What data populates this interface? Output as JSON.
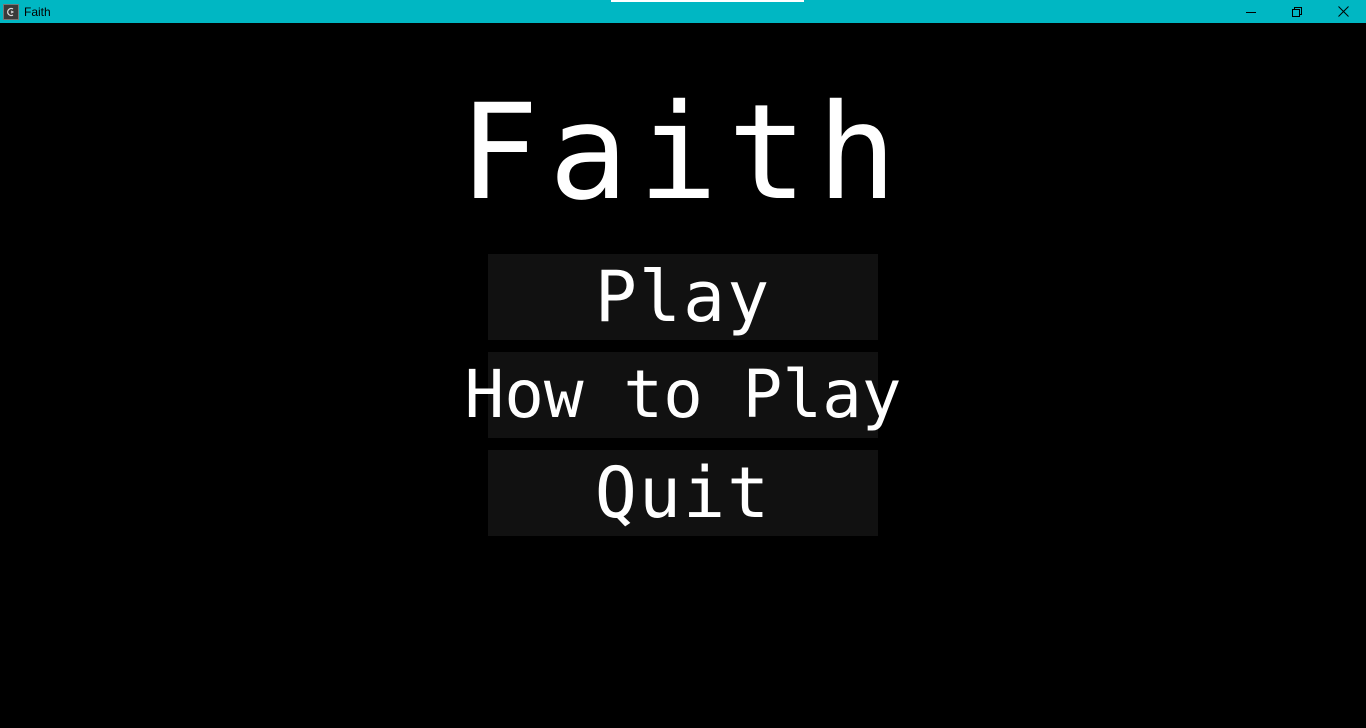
{
  "window": {
    "title": "Faith",
    "titlebar_color": "#00b7c3",
    "controls": [
      "minimize-icon",
      "restore-icon",
      "close-icon"
    ]
  },
  "game": {
    "background": "#000000",
    "title": "Faith",
    "menu": {
      "play_label": "Play",
      "how_to_play_label": "How to Play",
      "quit_label": "Quit",
      "button_color": "#111111",
      "text_color": "#ffffff"
    }
  }
}
